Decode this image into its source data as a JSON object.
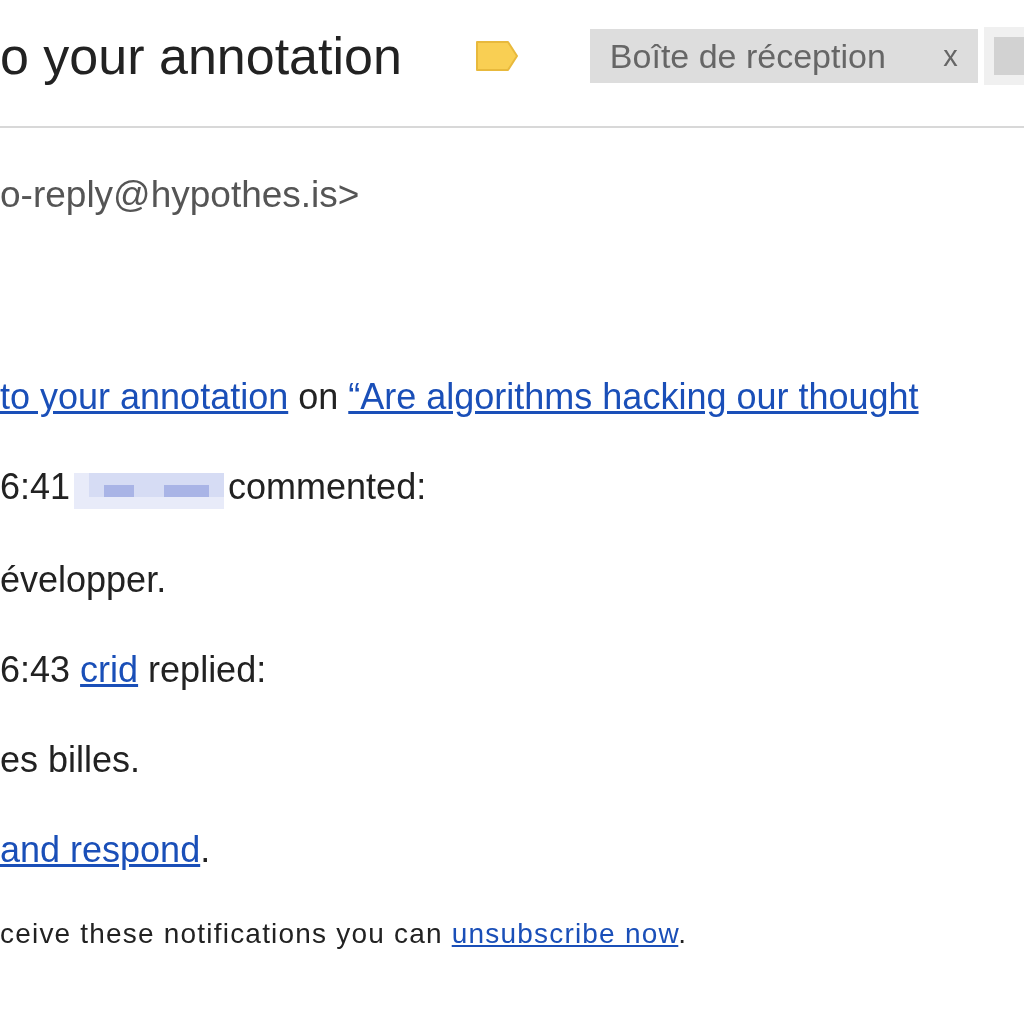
{
  "subject": "o your annotation",
  "chips": [
    {
      "label": "Boîte de réception",
      "close": "x"
    }
  ],
  "sender": "o-reply@hypothes.is>",
  "body": [
    {
      "kind": "message",
      "parts": [
        {
          "kind": "link",
          "text": "to your annotation"
        },
        {
          "kind": "text",
          "text": " on "
        },
        {
          "kind": "link",
          "text": "“Are algorithms hacking our thought"
        }
      ]
    },
    {
      "kind": "message",
      "parts": [
        {
          "kind": "text",
          "text": "6:41"
        },
        {
          "kind": "redacted"
        },
        {
          "kind": "text",
          "text": "commented:"
        }
      ]
    },
    {
      "kind": "message",
      "parts": [
        {
          "kind": "text",
          "text": "évelopper."
        }
      ]
    },
    {
      "kind": "message",
      "parts": [
        {
          "kind": "text",
          "text": "6:43 "
        },
        {
          "kind": "link",
          "text": "crid"
        },
        {
          "kind": "text",
          "text": " replied:"
        }
      ]
    },
    {
      "kind": "message",
      "parts": [
        {
          "kind": "text",
          "text": "es billes."
        }
      ]
    },
    {
      "kind": "message",
      "parts": [
        {
          "kind": "link",
          "text": "and respond"
        },
        {
          "kind": "text",
          "text": "."
        }
      ]
    },
    {
      "kind": "footer",
      "parts": [
        {
          "kind": "text",
          "text": "ceive these notifications you can "
        },
        {
          "kind": "link",
          "text": "unsubscribe now"
        },
        {
          "kind": "text",
          "text": "."
        }
      ]
    }
  ]
}
